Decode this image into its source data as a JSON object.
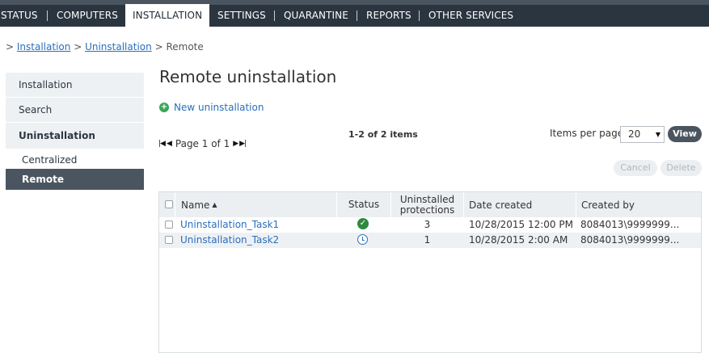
{
  "topnav": {
    "tabs": [
      {
        "label": "STATUS",
        "active": false
      },
      {
        "label": "COMPUTERS",
        "active": false
      },
      {
        "label": "INSTALLATION",
        "active": true
      },
      {
        "label": "SETTINGS",
        "active": false
      },
      {
        "label": "QUARANTINE",
        "active": false
      },
      {
        "label": "REPORTS",
        "active": false
      },
      {
        "label": "OTHER SERVICES",
        "active": false
      }
    ]
  },
  "breadcrumb": {
    "prefix": ">",
    "items": [
      "Installation",
      "Uninstallation"
    ],
    "separator": ">",
    "current": "Remote"
  },
  "sidebar": {
    "items": [
      {
        "label": "Installation"
      },
      {
        "label": "Search"
      },
      {
        "label": "Uninstallation"
      }
    ],
    "subitems": [
      {
        "label": "Centralized",
        "active": false
      },
      {
        "label": "Remote",
        "active": true
      }
    ]
  },
  "main": {
    "title": "Remote uninstallation",
    "new_label": "New uninstallation",
    "items_count": "1-2 of 2 items",
    "page_info": "Page 1 of 1",
    "items_per_page_label": "Items per page",
    "items_per_page_value": "20",
    "view_label": "View",
    "cancel_label": "Cancel",
    "delete_label": "Delete"
  },
  "table": {
    "columns": [
      "Name",
      "Status",
      "Uninstalled protections",
      "Date created",
      "Created by"
    ],
    "rows": [
      {
        "name": "Uninstallation_Task1",
        "status": "completed",
        "protections": "3",
        "date": "10/28/2015 12:00 PM",
        "created_by": "8084013\\9999999..."
      },
      {
        "name": "Uninstallation_Task2",
        "status": "pending",
        "protections": "1",
        "date": "10/28/2015 2:00 AM",
        "created_by": "8084013\\9999999..."
      }
    ]
  },
  "colors": {
    "nav_bg": "#2b3540",
    "accent_link": "#2a6fbb",
    "active_side": "#4b5560",
    "status_ok": "#2c8a3e"
  }
}
